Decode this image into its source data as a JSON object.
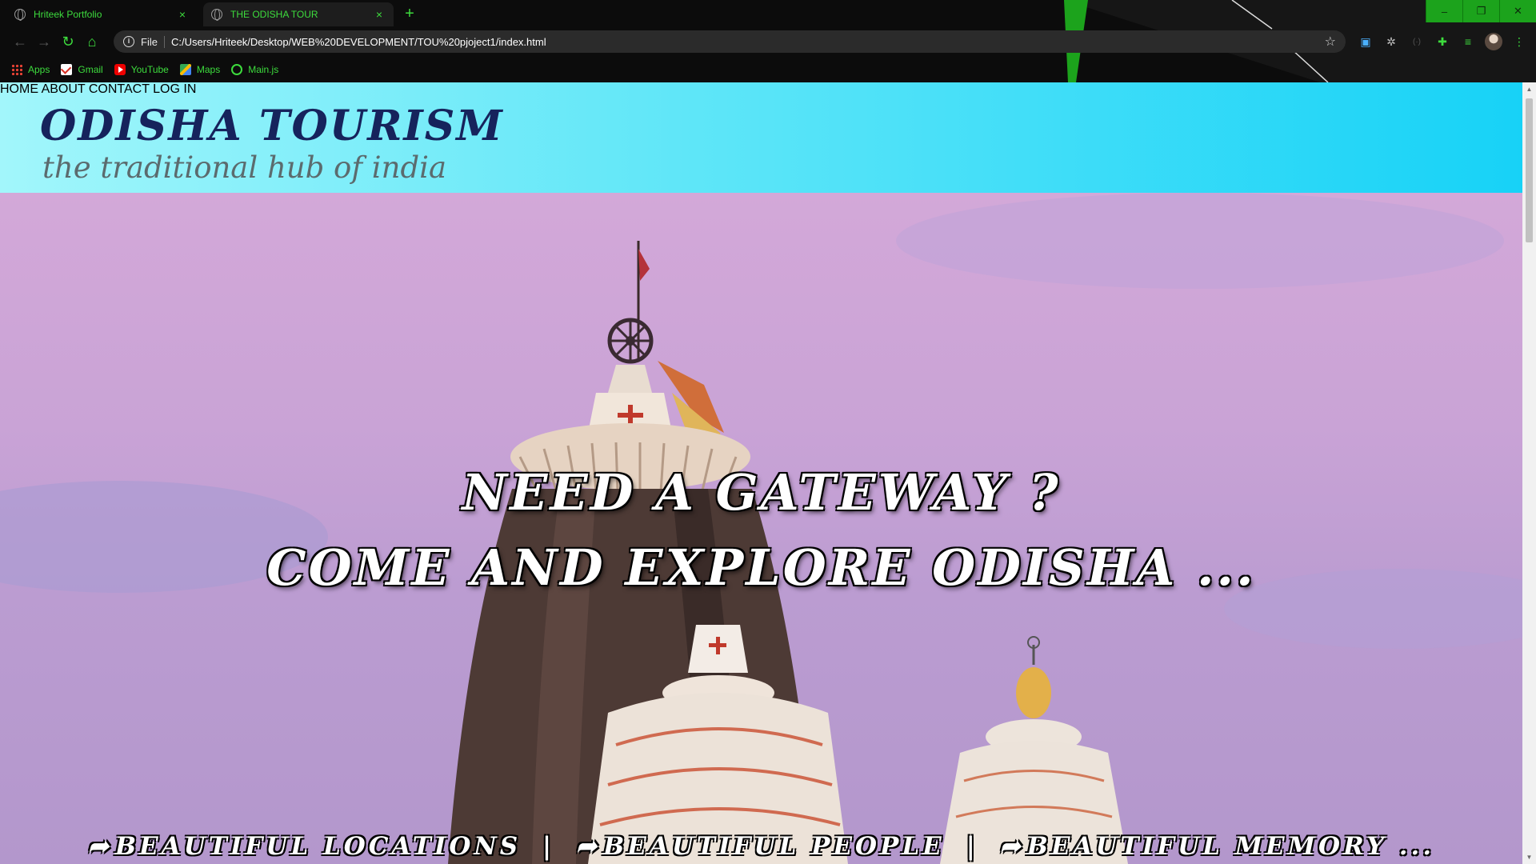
{
  "browser": {
    "tabs": [
      {
        "title": "Hriteek Portfolio",
        "close": "×"
      },
      {
        "title": "THE ODISHA TOUR",
        "close": "×"
      }
    ],
    "new_tab": "+",
    "window_controls": {
      "minimize": "–",
      "restore": "❐",
      "close": "✕"
    },
    "nav": {
      "back": "←",
      "forward": "→",
      "reload": "↻",
      "home": "⌂"
    },
    "address": {
      "info": "i",
      "scheme": "File",
      "url": "C:/Users/Hriteek/Desktop/WEB%20DEVELOPMENT/TOU%20pjoject1/index.html",
      "star": "☆"
    },
    "extensions": [
      "translate-icon",
      "gear-icon",
      "cast-icon",
      "puzzle-icon",
      "playlist-icon",
      "avatar",
      "more-icon"
    ],
    "bookmarks": [
      {
        "label": "Apps",
        "icon": "apps-icon"
      },
      {
        "label": "Gmail",
        "icon": "gmail-icon"
      },
      {
        "label": "YouTube",
        "icon": "youtube-icon"
      },
      {
        "label": "Maps",
        "icon": "maps-icon"
      },
      {
        "label": "Main.js",
        "icon": "globe-icon"
      }
    ],
    "accent_color": "#3ddc3d"
  },
  "site": {
    "brand": {
      "title": "ODISHA TOURISM",
      "tagline": "the traditional hub of india"
    },
    "nav": [
      "HOME",
      "ABOUT",
      "CONTACT",
      "LOG IN"
    ],
    "hero": {
      "line1": "NEED A GATEWAY ?",
      "line2": "COME AND EXPLORE ODISHA ...",
      "strip": [
        {
          "icon": "share-arrow-icon",
          "text": "BEAUTIFUL LOCATIONS"
        },
        {
          "icon": "share-arrow-icon",
          "text": "BEAUTIFUL PEOPLE"
        },
        {
          "icon": "share-arrow-icon",
          "text": "BEAUTIFUL MEMORY ..."
        }
      ],
      "separator": "|"
    },
    "colors": {
      "header_start": "#a2f6fb",
      "header_end": "#17d2f7",
      "brand": "#16235c",
      "tagline": "#5b6b6e"
    }
  }
}
